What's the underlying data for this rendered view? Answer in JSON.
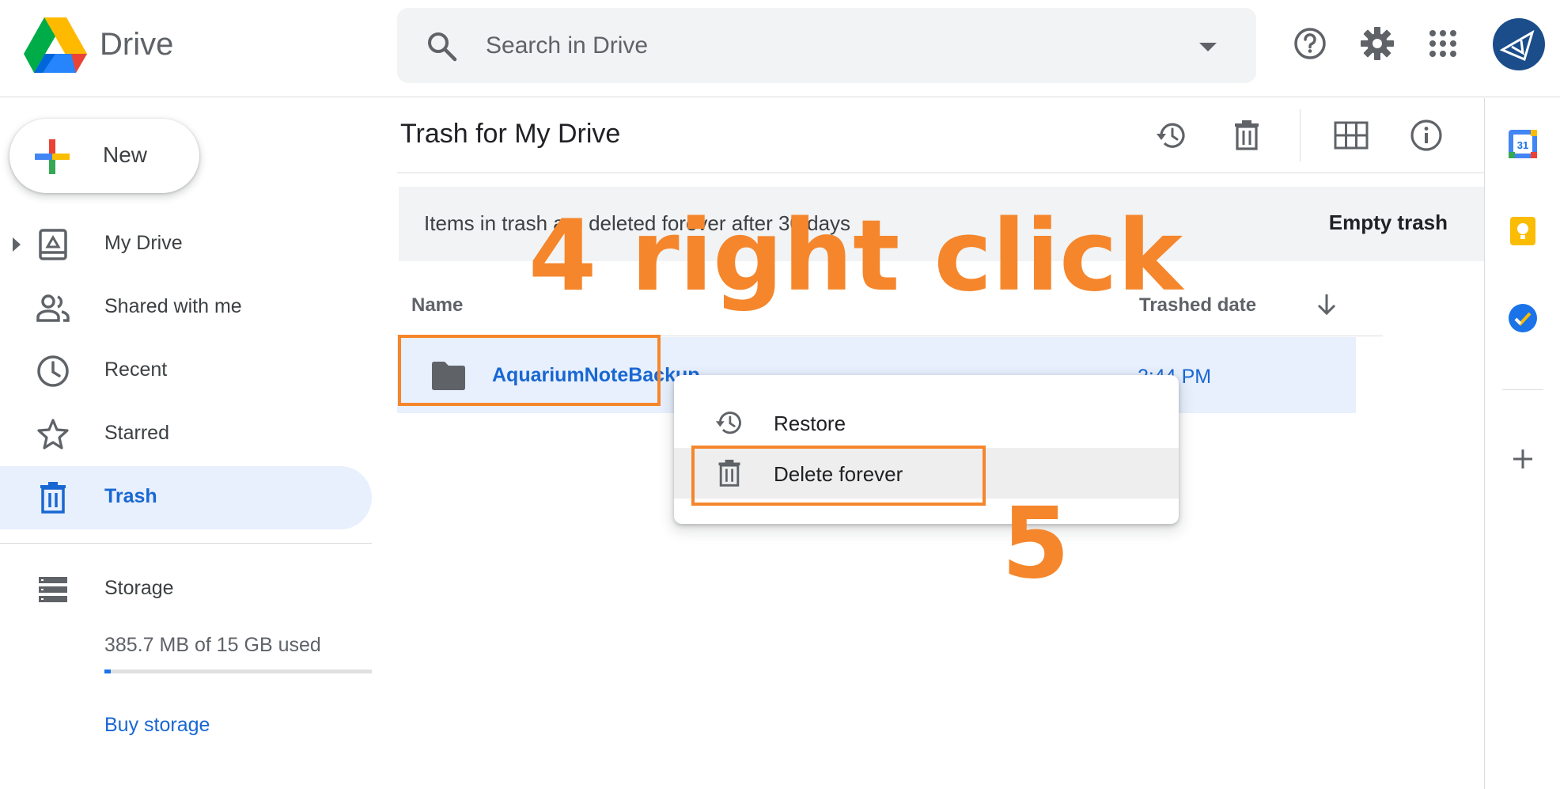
{
  "header": {
    "app_name": "Drive",
    "search_placeholder": "Search in Drive"
  },
  "sidebar": {
    "new_label": "New",
    "items": [
      {
        "label": "My Drive",
        "icon": "my-drive-icon"
      },
      {
        "label": "Shared with me",
        "icon": "shared-icon"
      },
      {
        "label": "Recent",
        "icon": "clock-icon"
      },
      {
        "label": "Starred",
        "icon": "star-icon"
      },
      {
        "label": "Trash",
        "icon": "trash-icon",
        "active": true
      }
    ],
    "storage": {
      "label": "Storage",
      "usage_text": "385.7 MB of 15 GB used",
      "used_fraction": 0.025,
      "buy_label": "Buy storage"
    }
  },
  "main": {
    "title": "Trash for My Drive",
    "banner": {
      "message": "Items in trash are deleted forever after 30 days",
      "empty_label": "Empty trash"
    },
    "columns": {
      "name": "Name",
      "trashed_date": "Trashed date"
    },
    "rows": [
      {
        "name": "AquariumNoteBackup",
        "trashed_date": "2:44 PM"
      }
    ]
  },
  "context_menu": {
    "items": [
      {
        "label": "Restore",
        "icon": "restore-icon"
      },
      {
        "label": "Delete forever",
        "icon": "trash-icon"
      }
    ]
  },
  "annotations": {
    "step4": "4 right click",
    "step5": "5"
  },
  "colors": {
    "accent": "#1a73e8",
    "active_bg": "#e8f0fe",
    "annotation": "#f5862c"
  }
}
